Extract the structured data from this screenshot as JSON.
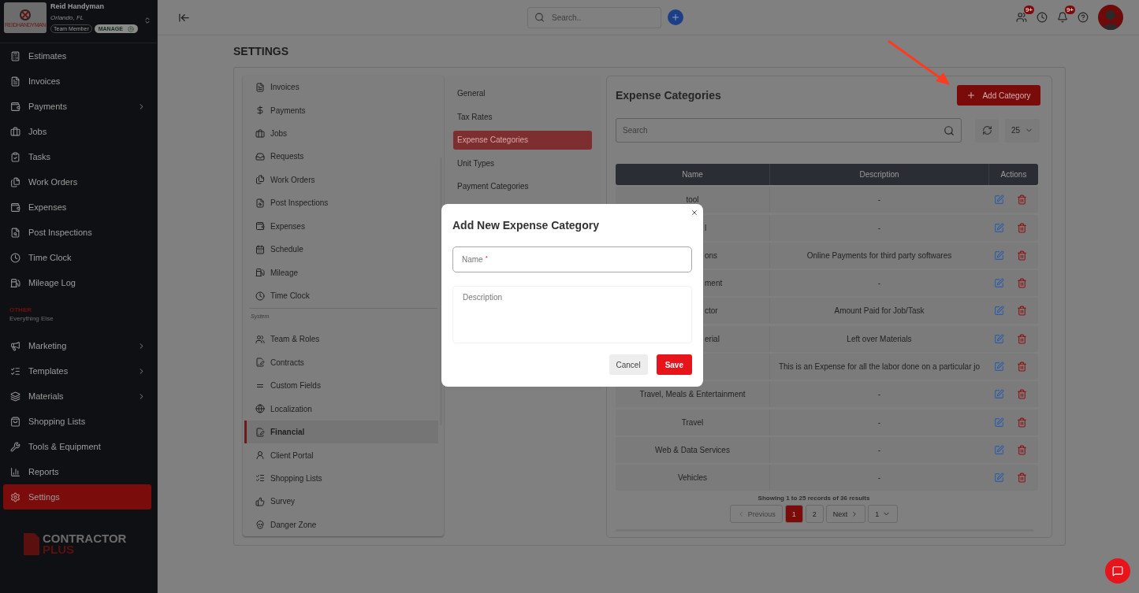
{
  "sidebar": {
    "company": {
      "logo_text": "REIDHANDYMAN",
      "name": "Reid Handyman",
      "location": "Orlando, FL",
      "role": "Team Member",
      "manage": "MANAGE"
    },
    "items": [
      {
        "label": "Estimates",
        "submenu": false,
        "selected": false
      },
      {
        "label": "Invoices",
        "submenu": false,
        "selected": false
      },
      {
        "label": "Payments",
        "submenu": true,
        "selected": false
      },
      {
        "label": "Jobs",
        "submenu": false,
        "selected": false
      },
      {
        "label": "Tasks",
        "submenu": false,
        "selected": false
      },
      {
        "label": "Work Orders",
        "submenu": false,
        "selected": false
      },
      {
        "label": "Expenses",
        "submenu": false,
        "selected": false
      },
      {
        "label": "Post Inspections",
        "submenu": false,
        "selected": false
      },
      {
        "label": "Time Clock",
        "submenu": false,
        "selected": false
      },
      {
        "label": "Mileage Log",
        "submenu": false,
        "selected": false
      }
    ],
    "section": {
      "title": "OTHER",
      "subtitle": "Everything Else"
    },
    "other_items": [
      {
        "label": "Marketing",
        "submenu": true,
        "selected": false
      },
      {
        "label": "Templates",
        "submenu": true,
        "selected": false
      },
      {
        "label": "Materials",
        "submenu": true,
        "selected": false
      },
      {
        "label": "Shopping Lists",
        "submenu": false,
        "selected": false
      },
      {
        "label": "Tools & Equipment",
        "submenu": false,
        "selected": false
      },
      {
        "label": "Reports",
        "submenu": false,
        "selected": false
      },
      {
        "label": "Settings",
        "submenu": false,
        "selected": true
      }
    ],
    "brand": {
      "line_1": "CONTRACTOR",
      "line_2": "PLUS"
    }
  },
  "topbar": {
    "search": {
      "placeholder": "Search.."
    },
    "badges": [
      "9+",
      "9+"
    ]
  },
  "page_title": "SETTINGS",
  "settings_nav": {
    "items": [
      {
        "label": "Invoices",
        "selected": false
      },
      {
        "label": "Payments",
        "selected": false
      },
      {
        "label": "Jobs",
        "selected": false
      },
      {
        "label": "Requests",
        "selected": false
      },
      {
        "label": "Work Orders",
        "selected": false
      },
      {
        "label": "Post Inspections",
        "selected": false
      },
      {
        "label": "Expenses",
        "selected": false
      },
      {
        "label": "Schedule",
        "selected": false
      },
      {
        "label": "Mileage",
        "selected": false
      },
      {
        "label": "Time Clock",
        "selected": false
      }
    ],
    "section": "System",
    "system_items": [
      {
        "label": "Team & Roles",
        "selected": false
      },
      {
        "label": "Contracts",
        "selected": false
      },
      {
        "label": "Custom Fields",
        "selected": false
      },
      {
        "label": "Localization",
        "selected": false
      },
      {
        "label": "Financial",
        "selected": true
      },
      {
        "label": "Client Portal",
        "selected": false
      },
      {
        "label": "Shopping Lists",
        "selected": false
      },
      {
        "label": "Survey",
        "selected": false
      },
      {
        "label": "Danger Zone",
        "selected": false
      }
    ]
  },
  "financial_nav": [
    {
      "label": "General",
      "selected": false
    },
    {
      "label": "Tax Rates",
      "selected": false
    },
    {
      "label": "Expense Categories",
      "selected": true
    },
    {
      "label": "Unit Types",
      "selected": false
    },
    {
      "label": "Payment Categories",
      "selected": false
    }
  ],
  "expense_categories": {
    "title": "Expense Categories",
    "add_button": "Add Category",
    "search": {
      "placeholder": "Search"
    },
    "page_size": "25",
    "table": {
      "columns": [
        "Name",
        "Description",
        "Actions"
      ],
      "rows": [
        {
          "name": "tool",
          "clipped": false,
          "description": "-"
        },
        {
          "name": "l",
          "clipped": true,
          "description": "-"
        },
        {
          "name": "ons",
          "clipped": true,
          "description": "Online Payments for third party softwares"
        },
        {
          "name": "ment",
          "clipped": true,
          "description": "-"
        },
        {
          "name": "ctor",
          "clipped": true,
          "description": "Amount Paid for Job/Task"
        },
        {
          "name": "erial",
          "clipped": true,
          "description": "Left over Materials"
        },
        {
          "description": "This is an Expense for all the labor done on a particular jo"
        },
        {
          "name": "Travel, Meals & Entertainment",
          "clipped": false,
          "description": "-"
        },
        {
          "name": "Travel",
          "clipped": false,
          "description": "-"
        },
        {
          "name": "Web & Data Services",
          "clipped": false,
          "description": "-"
        },
        {
          "name": "Vehicles",
          "clipped": false,
          "description": "-"
        }
      ]
    },
    "summary": "Showing 1 to 25 records of 36 results",
    "pagination": {
      "previous": "Previous",
      "previous_disabled": true,
      "pages": [
        {
          "label": "1",
          "selected": true
        },
        {
          "label": "2",
          "selected": false
        }
      ],
      "next": "Next",
      "page_select": "1"
    }
  },
  "modal": {
    "title": "Add New Expense Category",
    "name_field": {
      "placeholder": "Name",
      "required_mark": "*"
    },
    "description_field": {
      "placeholder": "Description"
    },
    "cancel": "Cancel",
    "save": "Save"
  }
}
